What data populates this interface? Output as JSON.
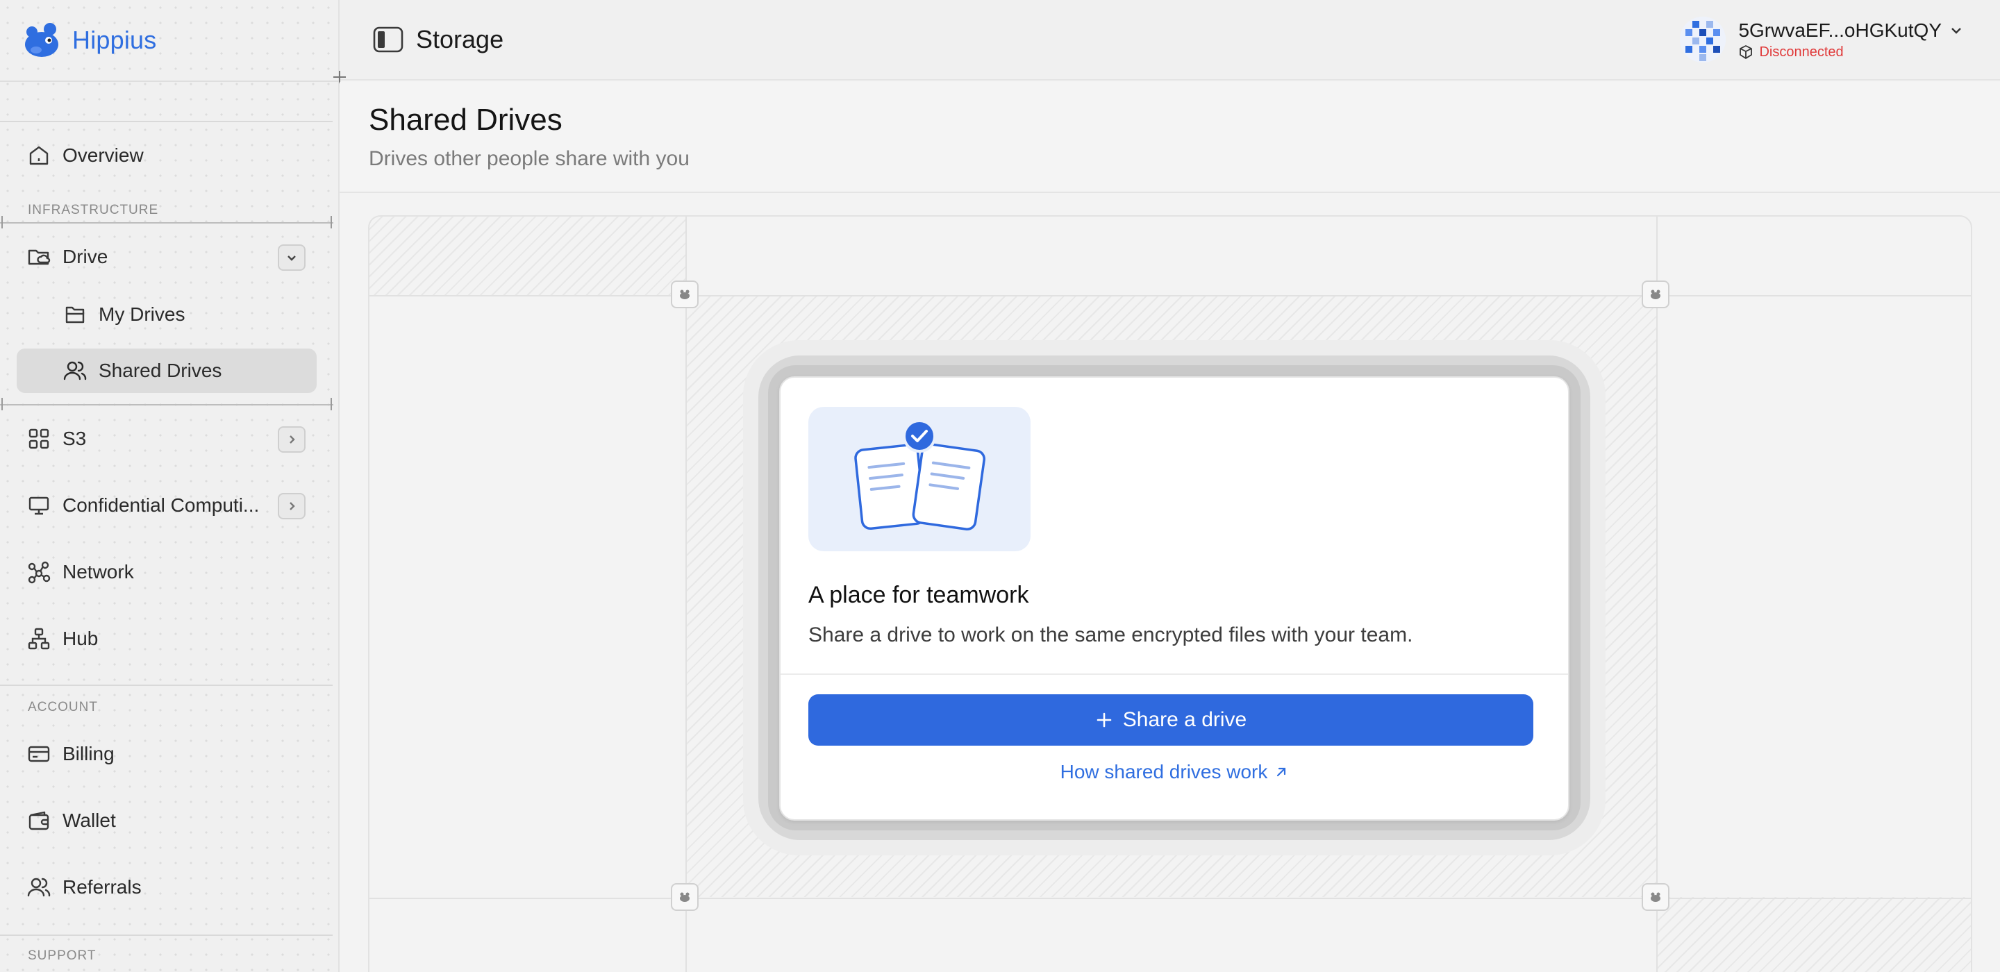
{
  "brand": {
    "name": "Hippius"
  },
  "header": {
    "title": "Storage",
    "account_id": "5GrwvaEF...oHGKutQY",
    "status": "Disconnected"
  },
  "sidebar": {
    "overview": "Overview",
    "section_infrastructure": "INFRASTRUCTURE",
    "drive": "Drive",
    "my_drives": "My Drives",
    "shared_drives": "Shared Drives",
    "s3": "S3",
    "confidential": "Confidential Computi...",
    "network": "Network",
    "hub": "Hub",
    "section_account": "ACCOUNT",
    "billing": "Billing",
    "wallet": "Wallet",
    "referrals": "Referrals",
    "section_support": "SUPPORT"
  },
  "page": {
    "title": "Shared Drives",
    "subtitle": "Drives other people share with you"
  },
  "card": {
    "title": "A place for teamwork",
    "text": "Share a drive to work on the same encrypted files with your team.",
    "button": "Share a drive",
    "link": "How shared drives work"
  },
  "colors": {
    "accent": "#2f69de",
    "status_error": "#e03a3a",
    "active_bg": "#dcdcdc"
  }
}
